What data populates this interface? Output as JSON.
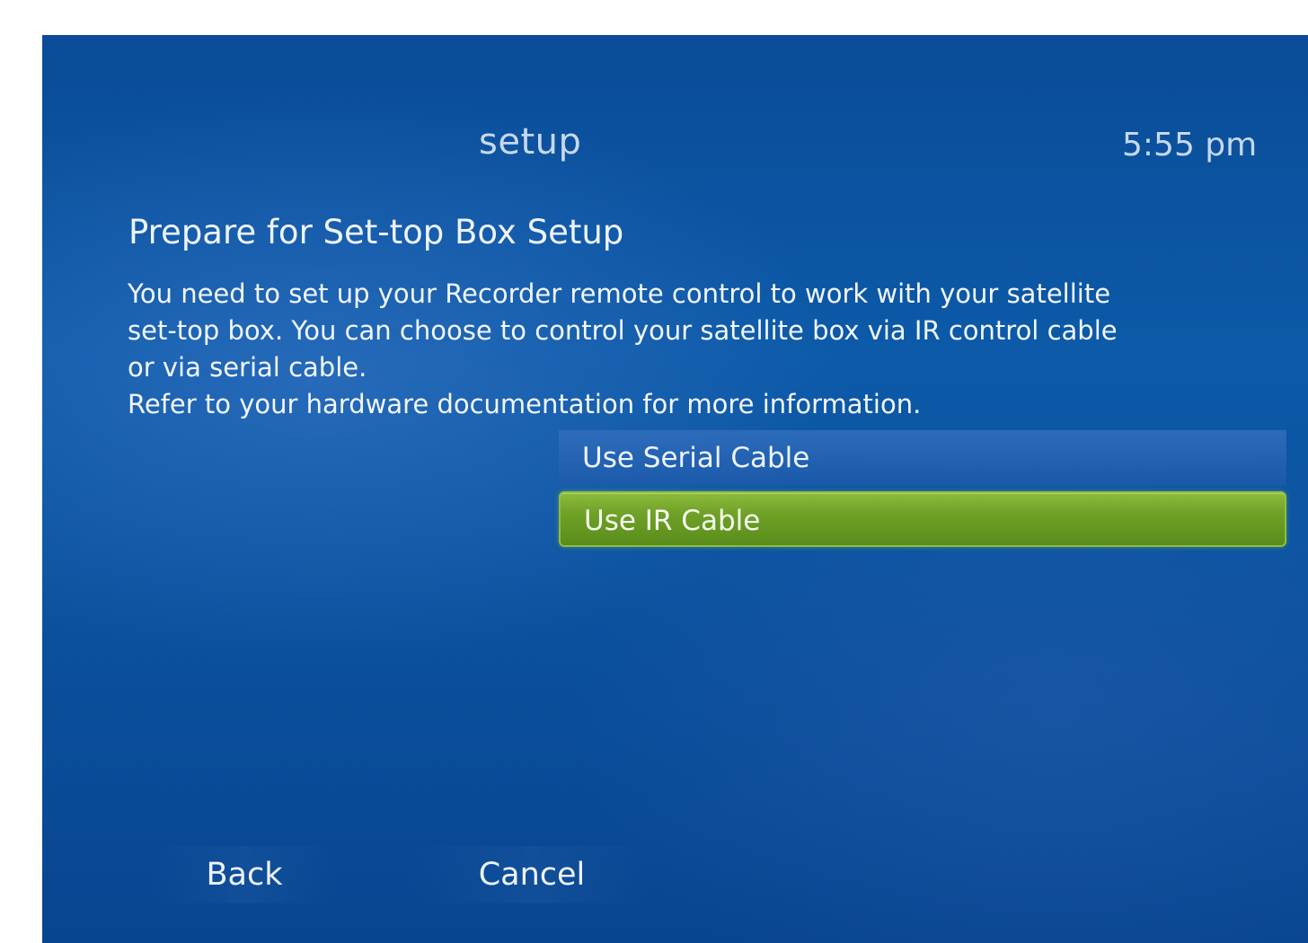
{
  "header": {
    "title": "setup",
    "clock": "5:55 pm"
  },
  "main": {
    "heading": "Prepare for Set-top Box Setup",
    "paragraph_lines": [
      "You need to set up your Recorder remote control to work with your satellite",
      "set-top box. You can choose to control your satellite box via IR control cable",
      "or via serial cable.",
      "Refer to your hardware documentation for more information."
    ],
    "options": [
      {
        "label": "Use Serial Cable",
        "selected": false
      },
      {
        "label": "Use IR Cable",
        "selected": true
      }
    ]
  },
  "footer": {
    "back_label": "Back",
    "cancel_label": "Cancel"
  },
  "colors": {
    "background": "#0a4f9c",
    "selected_highlight": "#6fa127",
    "text": "#eef4fb"
  }
}
